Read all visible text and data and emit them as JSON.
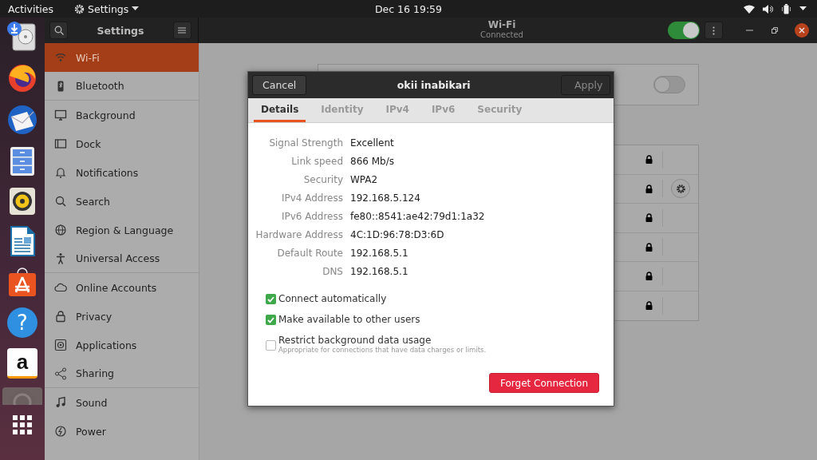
{
  "top_bar": {
    "activities": "Activities",
    "app_menu": "Settings",
    "clock": "Dec 16  19:59"
  },
  "dock": {
    "items": [
      {
        "kind": "drive"
      },
      {
        "kind": "browser"
      },
      {
        "kind": "mail"
      },
      {
        "kind": "files"
      },
      {
        "kind": "music"
      },
      {
        "kind": "writer"
      },
      {
        "kind": "store"
      },
      {
        "kind": "help",
        "label": "?"
      },
      {
        "kind": "shop",
        "label": "a"
      },
      {
        "kind": "settings"
      },
      {
        "kind": "apps"
      }
    ]
  },
  "sidebar": {
    "title": "Settings",
    "items": [
      {
        "label": "Wi-Fi",
        "selected": true
      },
      {
        "label": "Bluetooth",
        "selected": false
      },
      {
        "label": "Background",
        "selected": false
      },
      {
        "label": "Dock",
        "selected": false
      },
      {
        "label": "Notifications",
        "selected": false
      },
      {
        "label": "Search",
        "selected": false
      },
      {
        "label": "Region & Language",
        "selected": false
      },
      {
        "label": "Universal Access",
        "selected": false
      },
      {
        "label": "Online Accounts",
        "selected": false
      },
      {
        "label": "Privacy",
        "selected": false
      },
      {
        "label": "Applications",
        "selected": false
      },
      {
        "label": "Sharing",
        "selected": false
      },
      {
        "label": "Sound",
        "selected": false
      },
      {
        "label": "Power",
        "selected": false
      }
    ]
  },
  "header": {
    "title": "Wi-Fi",
    "subtitle": "Connected",
    "wifi_on": true
  },
  "airplane": {
    "on": false
  },
  "networks": [
    {
      "settings": false
    },
    {
      "settings": true
    },
    {
      "settings": false
    },
    {
      "settings": false
    },
    {
      "settings": false
    },
    {
      "settings": false
    }
  ],
  "dialog": {
    "title": "okii inabikari",
    "cancel": "Cancel",
    "apply": "Apply",
    "apply_disabled": true,
    "tabs": [
      {
        "label": "Details",
        "selected": true
      },
      {
        "label": "Identity",
        "selected": false
      },
      {
        "label": "IPv4",
        "selected": false
      },
      {
        "label": "IPv6",
        "selected": false
      },
      {
        "label": "Security",
        "selected": false
      }
    ],
    "details": [
      {
        "label": "Signal Strength",
        "value": "Excellent"
      },
      {
        "label": "Link speed",
        "value": "866 Mb/s"
      },
      {
        "label": "Security",
        "value": "WPA2"
      },
      {
        "label": "IPv4 Address",
        "value": "192.168.5.124"
      },
      {
        "label": "IPv6 Address",
        "value": "fe80::8541:ae42:79d1:1a32"
      },
      {
        "label": "Hardware Address",
        "value": "4C:1D:96:78:D3:6D"
      },
      {
        "label": "Default Route",
        "value": "192.168.5.1"
      },
      {
        "label": "DNS",
        "value": "192.168.5.1"
      }
    ],
    "options": [
      {
        "label": "Connect automatically",
        "checked": true
      },
      {
        "label": "Make available to other users",
        "checked": true
      },
      {
        "label": "Restrict background data usage",
        "checked": false,
        "hint": "Appropriate for connections that have data charges or limits."
      }
    ],
    "forget": "Forget Connection"
  }
}
